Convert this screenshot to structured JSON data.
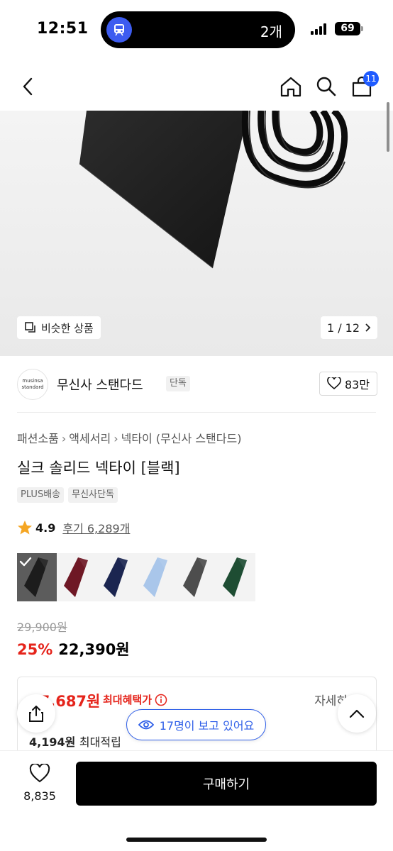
{
  "status": {
    "time": "12:51",
    "island_count": "2개",
    "battery": "69"
  },
  "header": {
    "cart_count": "11"
  },
  "hero": {
    "similar_label": "비슷한 상품",
    "page_indicator": "1 / 12"
  },
  "brand": {
    "logo_text_1": "musinsa",
    "logo_text_2": "standard",
    "name": "무신사 스탠다드",
    "tag": "단독",
    "likes": "83만"
  },
  "breadcrumb": [
    "패션소품",
    "액세서리",
    "넥타이 (무신사 스탠다드)"
  ],
  "product": {
    "title": "실크 솔리드 넥타이 [블랙]",
    "tags": [
      "PLUS배송",
      "무신사단독"
    ],
    "rating": "4.9",
    "reviews": "후기 6,289개",
    "colors": [
      "#1c1c1c",
      "#6e1825",
      "#1b2550",
      "#a9c6ea",
      "#4d4d4d",
      "#1e4d33"
    ],
    "original_price": "29,900원",
    "discount": "25%",
    "price": "22,390원"
  },
  "benefit": {
    "max_price": "17,687원",
    "max_label": "최대혜택가",
    "detail": "자세히",
    "points_value": "4,194원",
    "points_label": "최대적립"
  },
  "viewers": "17명이 보고 있어요",
  "bottom": {
    "wish_count": "8,835",
    "buy_label": "구매하기"
  }
}
